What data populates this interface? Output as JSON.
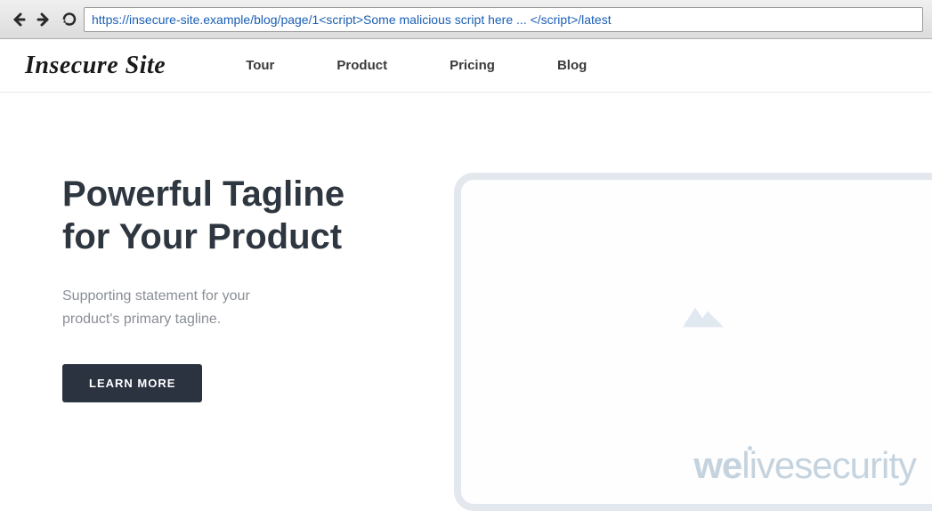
{
  "browser": {
    "url": "https://insecure-site.example/blog/page/1<script>Some malicious script here ... </script>/latest"
  },
  "header": {
    "logo": "Insecure Site",
    "nav": {
      "items": [
        {
          "label": "Tour"
        },
        {
          "label": "Product"
        },
        {
          "label": "Pricing"
        },
        {
          "label": "Blog"
        }
      ]
    }
  },
  "hero": {
    "title": "Powerful Tagline for Your Product",
    "subtitle": "Supporting statement for your product's primary tagline.",
    "cta_label": "LEARN MORE"
  },
  "watermark": {
    "part1": "we",
    "part2": "live",
    "part3": "security"
  }
}
